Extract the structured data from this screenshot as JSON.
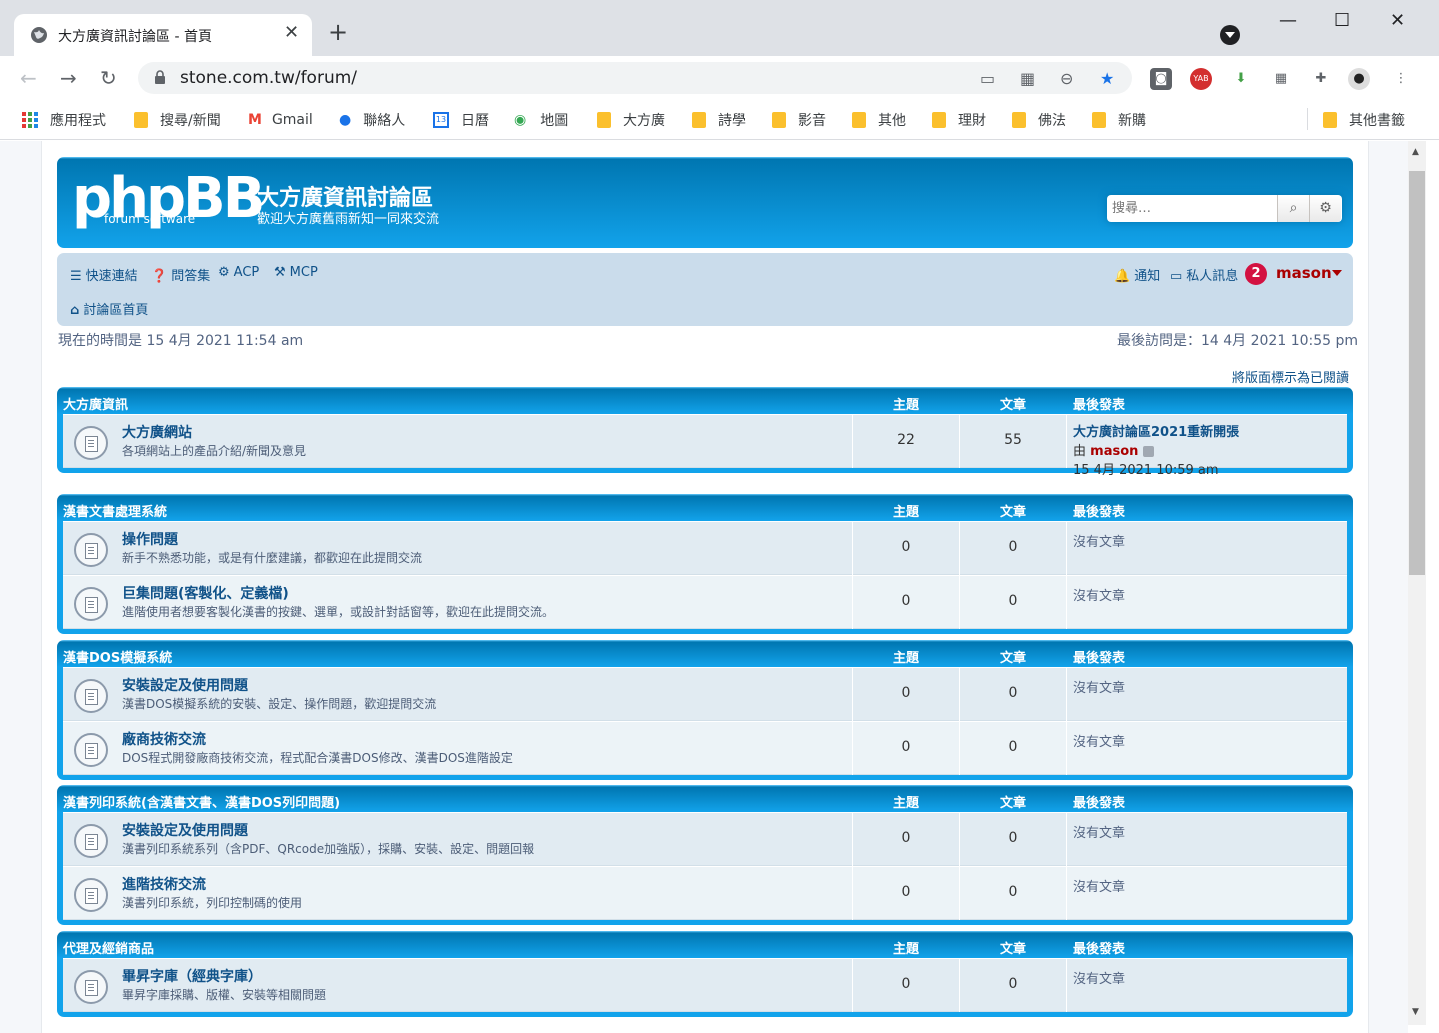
{
  "browser": {
    "tab_title": "大方廣資訊討論區 - 首頁",
    "url": "stone.com.tw/forum/",
    "bookmarks": [
      "應用程式",
      "搜尋/新聞",
      "Gmail",
      "聯絡人",
      "日曆",
      "地圖",
      "大方廣",
      "詩學",
      "影音",
      "其他",
      "理財",
      "佛法",
      "新購",
      "其他書籤"
    ]
  },
  "site": {
    "logo_big": "phpBB",
    "logo_small": "forum  software",
    "name": "大方廣資訊討論區",
    "description": "歡迎大方廣舊雨新知一同來交流",
    "search_placeholder": "搜尋…"
  },
  "nav": {
    "quick_links": "快速連結",
    "faq": "問答集",
    "acp": "ACP",
    "mcp": "MCP",
    "notifications": "通知",
    "pm": "私人訊息",
    "pm_count": "2",
    "user": "mason",
    "home": "討論區首頁"
  },
  "info": {
    "current_time": "現在的時間是 15 4月 2021 11:54 am",
    "last_visit": "最後訪問是：14 4月 2021 10:55 pm",
    "mark_read": "將版面標示為已閱讀"
  },
  "columns": {
    "topics": "主題",
    "posts": "文章",
    "last_post": "最後發表"
  },
  "categories": [
    {
      "title": "大方廣資訊",
      "forums": [
        {
          "name": "大方廣網站",
          "desc": "各項網站上的產品介紹/新聞及意見",
          "topics": "22",
          "posts": "55",
          "last_title": "大方廣討論區2021重新開張",
          "last_by": "由",
          "last_user": "mason",
          "last_time": "15 4月 2021 10:59 am"
        }
      ]
    },
    {
      "title": "漢書文書處理系統",
      "forums": [
        {
          "name": "操作問題",
          "desc": "新手不熟悉功能，或是有什麼建議，都歡迎在此提問交流",
          "topics": "0",
          "posts": "0",
          "no_posts": "沒有文章"
        },
        {
          "name": "巨集問題(客製化、定義檔)",
          "desc": "進階使用者想要客製化漢書的按鍵、選單，或設計對話窗等，歡迎在此提問交流。",
          "topics": "0",
          "posts": "0",
          "no_posts": "沒有文章"
        }
      ]
    },
    {
      "title": "漢書DOS模擬系統",
      "forums": [
        {
          "name": "安裝設定及使用問題",
          "desc": "漢書DOS模擬系統的安裝、設定、操作問題，歡迎提問交流",
          "topics": "0",
          "posts": "0",
          "no_posts": "沒有文章"
        },
        {
          "name": "廠商技術交流",
          "desc": "DOS程式開發廠商技術交流，程式配合漢書DOS修改、漢書DOS進階設定",
          "topics": "0",
          "posts": "0",
          "no_posts": "沒有文章"
        }
      ]
    },
    {
      "title": "漢書列印系統(含漢書文書、漢書DOS列印問題)",
      "forums": [
        {
          "name": "安裝設定及使用問題",
          "desc": "漢書列印系統系列（含PDF、QRcode加強版），採購、安裝、設定、問題回報",
          "topics": "0",
          "posts": "0",
          "no_posts": "沒有文章"
        },
        {
          "name": "進階技術交流",
          "desc": "漢書列印系統，列印控制碼的使用",
          "topics": "0",
          "posts": "0",
          "no_posts": "沒有文章"
        }
      ]
    },
    {
      "title": "代理及經銷商品",
      "forums": [
        {
          "name": "畢昇字庫（經典字庫）",
          "desc": "畢昇字庫採購、版權、安裝等相關問題",
          "topics": "0",
          "posts": "0",
          "no_posts": "沒有文章"
        }
      ]
    }
  ]
}
